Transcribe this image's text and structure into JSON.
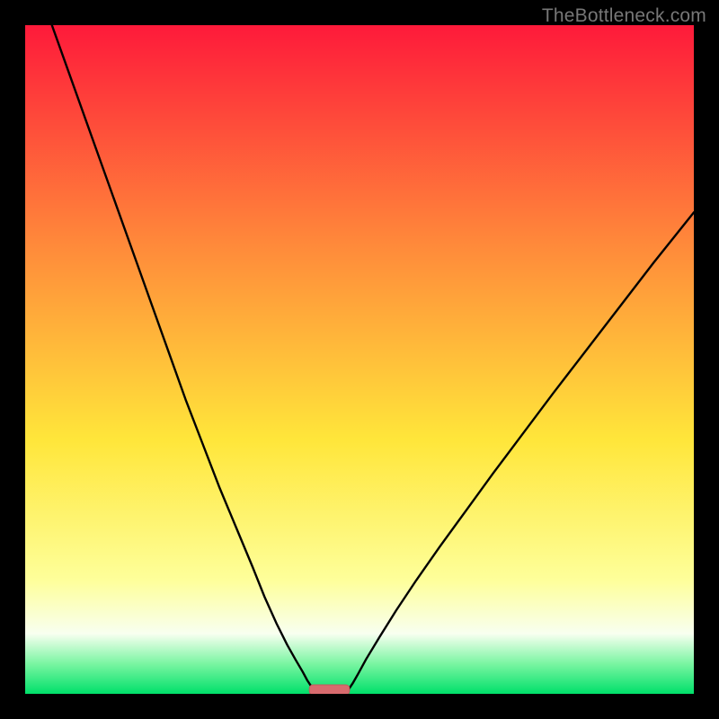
{
  "watermark": "TheBottleneck.com",
  "colors": {
    "black": "#000000",
    "curve": "#000000",
    "marker_fill": "#d86b6e",
    "marker_stroke": "#c55a5d",
    "grad_red": "#fe1a3a",
    "grad_orange": "#ff8a3a",
    "grad_yellow": "#ffe63a",
    "grad_paleyellow": "#feff9a",
    "grad_white": "#f8fff0",
    "grad_mint": "#7af5a2",
    "grad_green": "#00e06a"
  },
  "chart_data": {
    "type": "line",
    "title": "",
    "xlabel": "",
    "ylabel": "",
    "xlim": [
      0,
      100
    ],
    "ylim": [
      0,
      100
    ],
    "series": [
      {
        "name": "left-branch",
        "x": [
          4.0,
          6.5,
          9.0,
          11.5,
          14.0,
          16.5,
          19.0,
          21.5,
          24.0,
          26.5,
          29.0,
          31.5,
          34.0,
          35.8,
          37.6,
          39.2,
          40.5,
          41.5,
          42.2,
          42.8,
          43.2,
          43.5
        ],
        "y": [
          100.0,
          93.0,
          86.0,
          79.0,
          72.0,
          65.0,
          58.0,
          51.0,
          44.0,
          37.5,
          31.0,
          25.0,
          19.0,
          14.5,
          10.5,
          7.3,
          5.0,
          3.3,
          2.0,
          1.1,
          0.5,
          0.15
        ]
      },
      {
        "name": "right-branch",
        "x": [
          48.0,
          48.4,
          49.0,
          49.8,
          51.0,
          53.0,
          55.5,
          58.5,
          62.0,
          66.0,
          70.0,
          74.5,
          79.0,
          84.0,
          89.0,
          94.0,
          100.0
        ],
        "y": [
          0.15,
          0.7,
          1.6,
          3.0,
          5.2,
          8.5,
          12.5,
          17.0,
          22.0,
          27.5,
          33.0,
          39.0,
          45.0,
          51.5,
          58.0,
          64.5,
          72.0
        ]
      }
    ],
    "annotations": [
      {
        "name": "min-marker",
        "shape": "rounded-rect",
        "x_center": 45.5,
        "y": 0.0,
        "width": 6.0,
        "color": "#d86b6e"
      }
    ]
  }
}
